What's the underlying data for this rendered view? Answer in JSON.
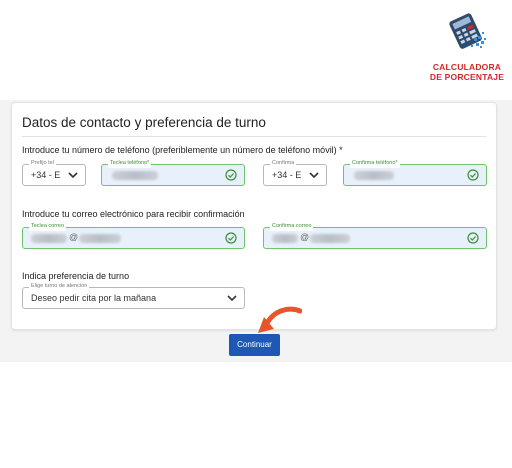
{
  "logo": {
    "line1": "CALCULADORA",
    "line2": "DE PORCENTAJE"
  },
  "form": {
    "title": "Datos de contacto y preferencia de turno",
    "phone_section": {
      "label": "Introduce tu número de teléfono (preferiblemente un número de teléfono móvil) *",
      "prefix_legend": "Prefijo tel",
      "prefix_value": "+34 - E",
      "phone_legend": "Teclea teléfono*",
      "confirm_prefix_legend": "Confirma",
      "confirm_prefix_value": "+34 - E",
      "confirm_phone_legend": "Confirma teléfono*"
    },
    "email_section": {
      "label": "Introduce tu correo electrónico para recibir confirmación",
      "email_legend": "Teclea correo",
      "email_at": "@",
      "confirm_email_legend": "Confirma correo",
      "confirm_email_at": "@"
    },
    "turno_section": {
      "label": "Indica preferencia de turno",
      "turno_legend": "Elige turno de atención",
      "turno_value": "Deseo pedir cita por la mañana"
    },
    "continue_label": "Continuar"
  },
  "colors": {
    "valid_border": "#6fc46a",
    "valid_bg": "#e8f0fc",
    "button": "#1f57b7",
    "arrow": "#e8552a",
    "logo_red": "#d7262b"
  }
}
